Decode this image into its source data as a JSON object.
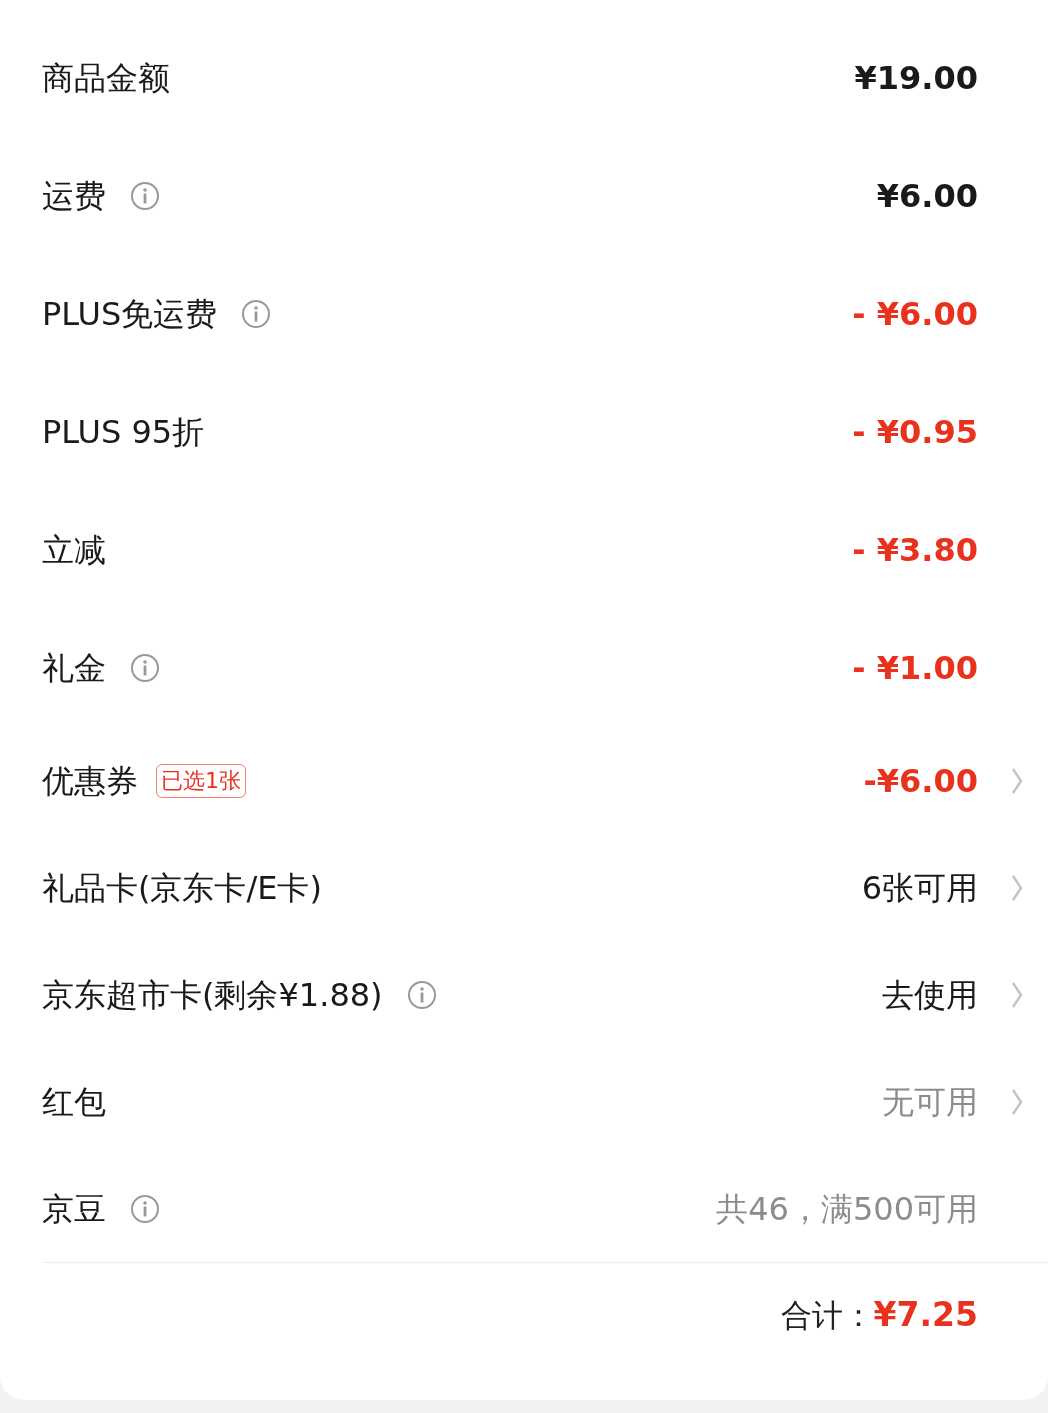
{
  "rows": [
    {
      "label": "商品金额",
      "info": false,
      "value": "¥19.00",
      "kind": "amount",
      "chevron": false
    },
    {
      "label": "运费",
      "info": true,
      "value": "¥6.00",
      "kind": "amount",
      "chevron": false
    },
    {
      "label": "PLUS免运费",
      "info": true,
      "value": "- ¥6.00",
      "kind": "discount",
      "chevron": false
    },
    {
      "label": "PLUS 95折",
      "info": false,
      "value": "- ¥0.95",
      "kind": "discount",
      "chevron": false
    },
    {
      "label": "立减",
      "info": false,
      "value": "- ¥3.80",
      "kind": "discount",
      "chevron": false
    },
    {
      "label": "礼金",
      "info": true,
      "value": "- ¥1.00",
      "kind": "discount",
      "chevron": false
    },
    {
      "label": "优惠券",
      "info": false,
      "badge": "已选1张",
      "value": "-¥6.00",
      "kind": "discount",
      "chevron": true
    },
    {
      "label": "礼品卡(京东卡/E卡)",
      "info": false,
      "value": "6张可用",
      "kind": "action",
      "chevron": true
    },
    {
      "label": "京东超市卡(剩余¥1.88)",
      "info": true,
      "value": "去使用",
      "kind": "action",
      "chevron": true
    },
    {
      "label": "红包",
      "info": false,
      "value": "无可用",
      "kind": "muted",
      "chevron": true
    },
    {
      "label": "京豆",
      "info": true,
      "value": "共46，满500可用",
      "kind": "muted",
      "chevron": false
    }
  ],
  "total": {
    "label": "合计：",
    "value": "¥7.25"
  }
}
